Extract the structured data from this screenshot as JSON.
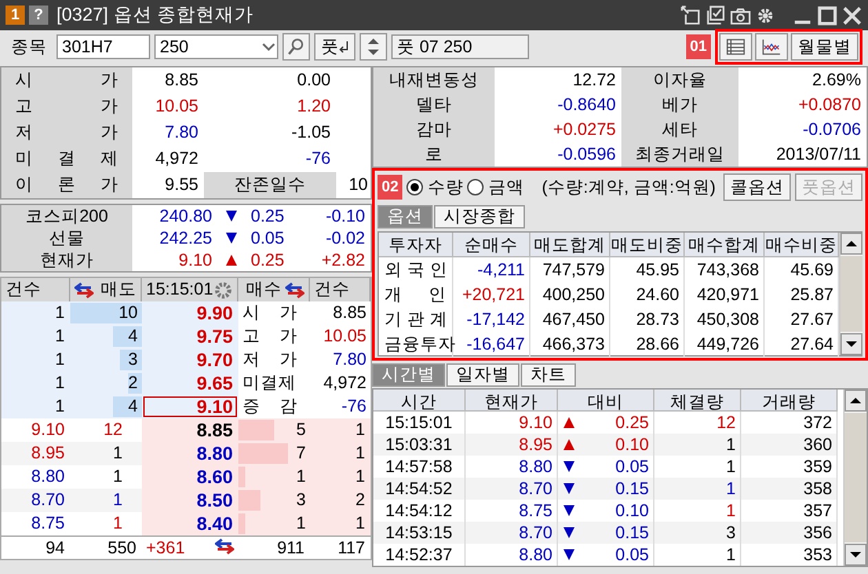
{
  "window": {
    "badge": "1",
    "help": "?",
    "title": "[0327] 옵션 종합현재가"
  },
  "toolbar": {
    "label": "종목",
    "code": "301H7",
    "strike": "250",
    "put_button": "풋",
    "name": "풋 07 250",
    "marker": "01",
    "monthly_button": "월물별"
  },
  "price_info": {
    "rows": [
      {
        "label": "시 가",
        "value": {
          "text": "8.85",
          "color": "#000000"
        },
        "change": {
          "text": "0.00",
          "color": "#000000"
        }
      },
      {
        "label": "고 가",
        "value": {
          "text": "10.05",
          "color": "#d40000"
        },
        "change": {
          "text": "1.20",
          "color": "#d40000"
        }
      },
      {
        "label": "저 가",
        "value": {
          "text": "7.80",
          "color": "#0000c0"
        },
        "change": {
          "text": "-1.05",
          "color": "#000000"
        }
      },
      {
        "label": "미 결 제",
        "value": {
          "text": "4,972",
          "color": "#000000"
        },
        "change": {
          "text": "-76",
          "color": "#0000c0"
        }
      },
      {
        "label": "이 론 가",
        "value": {
          "text": "9.55",
          "color": "#000000"
        }
      }
    ],
    "remaining": {
      "label": "잔존일수",
      "value": "10"
    }
  },
  "greeks": [
    {
      "label": "내재변동성",
      "value": "12.72",
      "color": "#000000"
    },
    {
      "label": "이자율",
      "value": "2.69%",
      "color": "#000000"
    },
    {
      "label": "델타",
      "value": "-0.8640",
      "color": "#0000c0"
    },
    {
      "label": "베가",
      "value": "+0.0870",
      "color": "#d40000"
    },
    {
      "label": "감마",
      "value": "+0.0275",
      "color": "#d40000"
    },
    {
      "label": "세타",
      "value": "-0.0706",
      "color": "#0000c0"
    },
    {
      "label": "로",
      "value": "-0.0596",
      "color": "#0000c0"
    },
    {
      "label": "최종거래일",
      "value": "2013/07/11",
      "color": "#000000"
    }
  ],
  "index": [
    {
      "label": "코스피200",
      "value": "240.80",
      "rising": false,
      "color": "#0000c0",
      "change": "0.25",
      "rate": "-0.10"
    },
    {
      "label": "선물",
      "value": "242.25",
      "rising": false,
      "color": "#0000c0",
      "change": "0.05",
      "rate": "-0.02"
    },
    {
      "label": "현재가",
      "value": "9.10",
      "rising": true,
      "color": "#d40000",
      "change": "0.25",
      "rate": "+2.82"
    }
  ],
  "order_book": {
    "columns": [
      "건수",
      "매도",
      "15:15:01",
      "매수",
      "건수"
    ],
    "asks": [
      {
        "count": "1",
        "qty": "10",
        "level": 1.0,
        "price": {
          "text": "9.90",
          "color": "#d40000"
        },
        "current": false
      },
      {
        "count": "1",
        "qty": "4",
        "level": 0.4,
        "price": {
          "text": "9.75",
          "color": "#d40000"
        },
        "current": false
      },
      {
        "count": "1",
        "qty": "3",
        "level": 0.3,
        "price": {
          "text": "9.70",
          "color": "#d40000"
        },
        "current": false
      },
      {
        "count": "1",
        "qty": "2",
        "level": 0.2,
        "price": {
          "text": "9.65",
          "color": "#d40000"
        },
        "current": false
      },
      {
        "count": "1",
        "qty": "4",
        "level": 0.4,
        "price": {
          "text": "9.10",
          "color": "#d40000"
        },
        "current": true
      }
    ],
    "summary": [
      {
        "label": "시 가",
        "value": "8.85",
        "color": "#000000"
      },
      {
        "label": "고 가",
        "value": "10.05",
        "color": "#d40000"
      },
      {
        "label": "저 가",
        "value": "7.80",
        "color": "#0000c0"
      },
      {
        "label": "미결제",
        "value": "4,972",
        "color": "#000000"
      },
      {
        "label": "증 감",
        "value": "-76",
        "color": "#0000c0"
      }
    ],
    "bids": [
      {
        "tick_price": {
          "text": "9.10",
          "color": "#d40000"
        },
        "tick_qty": {
          "text": "12",
          "color": "#d40000"
        },
        "price": {
          "text": "8.85",
          "color": "#000000"
        },
        "qty": "5",
        "level": 0.5,
        "count": "1"
      },
      {
        "tick_price": {
          "text": "8.95",
          "color": "#d40000"
        },
        "tick_qty": {
          "text": "1",
          "color": "#000000"
        },
        "price": {
          "text": "8.80",
          "color": "#0000c0"
        },
        "qty": "7",
        "level": 0.7,
        "count": "1"
      },
      {
        "tick_price": {
          "text": "8.80",
          "color": "#0000c0"
        },
        "tick_qty": {
          "text": "1",
          "color": "#000000"
        },
        "price": {
          "text": "8.60",
          "color": "#0000c0"
        },
        "qty": "1",
        "level": 0.1,
        "count": "1"
      },
      {
        "tick_price": {
          "text": "8.70",
          "color": "#0000c0"
        },
        "tick_qty": {
          "text": "1",
          "color": "#0000c0"
        },
        "price": {
          "text": "8.50",
          "color": "#0000c0"
        },
        "qty": "3",
        "level": 0.3,
        "count": "2"
      },
      {
        "tick_price": {
          "text": "8.75",
          "color": "#0000c0"
        },
        "tick_qty": {
          "text": "1",
          "color": "#d40000"
        },
        "price": {
          "text": "8.40",
          "color": "#0000c0"
        },
        "qty": "1",
        "level": 0.1,
        "count": "1"
      }
    ],
    "totals": {
      "ask_count": "94",
      "ask_qty": "550",
      "diff": {
        "text": "+361",
        "color": "#d40000"
      },
      "bid_qty": "911",
      "bid_count": "117"
    }
  },
  "investor": {
    "marker": "02",
    "options": [
      {
        "label": "수량",
        "selected": true
      },
      {
        "label": "금액",
        "selected": false
      }
    ],
    "note": "(수량:계약, 금액:억원)",
    "buttons": [
      {
        "label": "콜옵션",
        "disabled": false
      },
      {
        "label": "풋옵션",
        "disabled": true
      }
    ],
    "tabs": [
      {
        "label": "옵션",
        "selected": true
      },
      {
        "label": "시장종합",
        "selected": false
      }
    ],
    "columns": [
      "투자자",
      "순매수",
      "매도합계",
      "매도비중",
      "매수합계",
      "매수비중"
    ],
    "rows": [
      {
        "investor": "외 국 인",
        "net": {
          "text": "-4,211",
          "color": "#0000c0"
        },
        "sell": "747,579",
        "sell_ratio": "45.95",
        "buy": "743,368",
        "buy_ratio": "45.69"
      },
      {
        "investor": "개 인",
        "net": {
          "text": "+20,721",
          "color": "#d40000"
        },
        "sell": "400,250",
        "sell_ratio": "24.60",
        "buy": "420,971",
        "buy_ratio": "25.87"
      },
      {
        "investor": "기 관 계",
        "net": {
          "text": "-17,142",
          "color": "#0000c0"
        },
        "sell": "467,450",
        "sell_ratio": "28.73",
        "buy": "450,308",
        "buy_ratio": "27.67"
      },
      {
        "investor": "금융투자",
        "net": {
          "text": "-16,647",
          "color": "#0000c0"
        },
        "sell": "466,373",
        "sell_ratio": "28.66",
        "buy": "449,726",
        "buy_ratio": "27.64"
      }
    ]
  },
  "trades": {
    "tabs": [
      {
        "label": "시간별",
        "selected": true
      },
      {
        "label": "일자별",
        "selected": false
      },
      {
        "label": "차트",
        "selected": false
      }
    ],
    "columns": [
      "시간",
      "현재가",
      "대비",
      "체결량",
      "거래량"
    ],
    "rows": [
      {
        "time": "15:15:01",
        "price": "9.10",
        "rising": true,
        "color": "#d40000",
        "change": "0.25",
        "volume": {
          "text": "12",
          "color": "#d40000"
        },
        "total": "372"
      },
      {
        "time": "15:03:31",
        "price": "8.95",
        "rising": true,
        "color": "#d40000",
        "change": "0.10",
        "volume": {
          "text": "1",
          "color": "#000000"
        },
        "total": "360"
      },
      {
        "time": "14:57:58",
        "price": "8.80",
        "rising": false,
        "color": "#0000c0",
        "change": "0.05",
        "volume": {
          "text": "1",
          "color": "#000000"
        },
        "total": "359"
      },
      {
        "time": "14:54:52",
        "price": "8.70",
        "rising": false,
        "color": "#0000c0",
        "change": "0.15",
        "volume": {
          "text": "1",
          "color": "#0000c0"
        },
        "total": "358"
      },
      {
        "time": "14:54:12",
        "price": "8.75",
        "rising": false,
        "color": "#0000c0",
        "change": "0.10",
        "volume": {
          "text": "1",
          "color": "#d40000"
        },
        "total": "357"
      },
      {
        "time": "14:53:15",
        "price": "8.70",
        "rising": false,
        "color": "#0000c0",
        "change": "0.15",
        "volume": {
          "text": "3",
          "color": "#000000"
        },
        "total": "356"
      },
      {
        "time": "14:52:37",
        "price": "8.80",
        "rising": false,
        "color": "#0000c0",
        "change": "0.05",
        "volume": {
          "text": "1",
          "color": "#000000"
        },
        "total": "353"
      }
    ]
  }
}
